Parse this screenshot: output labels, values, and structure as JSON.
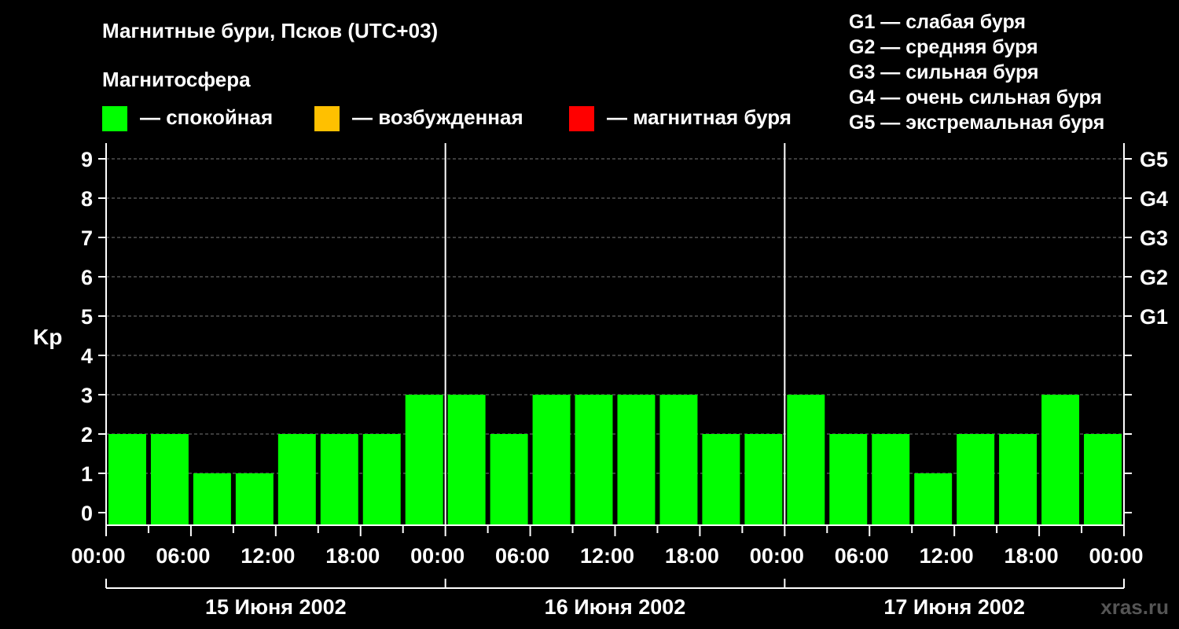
{
  "title": "Магнитные бури, Псков (UTC+03)",
  "magnetosphere_label": "Магнитосфера",
  "legend": [
    {
      "label": "— спокойная",
      "color": "#00ff00"
    },
    {
      "label": "— возбужденная",
      "color": "#ffc000"
    },
    {
      "label": "— магнитная буря",
      "color": "#ff0000"
    }
  ],
  "storm_levels": [
    "G1 — слабая буря",
    "G2 — средняя буря",
    "G3 — сильная буря",
    "G4 — очень сильная буря",
    "G5 — экстремальная буря"
  ],
  "watermark": "xras.ru",
  "chart_data": {
    "type": "bar",
    "ylabel": "Kp",
    "ylim": [
      0,
      9
    ],
    "y_ticks": [
      "0",
      "1",
      "2",
      "3",
      "4",
      "5",
      "6",
      "7",
      "8",
      "9"
    ],
    "right_ticks": [
      {
        "kp": 5,
        "label": "G1"
      },
      {
        "kp": 6,
        "label": "G2"
      },
      {
        "kp": 7,
        "label": "G3"
      },
      {
        "kp": 8,
        "label": "G4"
      },
      {
        "kp": 9,
        "label": "G5"
      }
    ],
    "grid": "dashed horizontal",
    "x_tick_labels": [
      "00:00",
      "06:00",
      "12:00",
      "18:00",
      "00:00",
      "06:00",
      "12:00",
      "18:00",
      "00:00",
      "06:00",
      "12:00",
      "18:00",
      "00:00"
    ],
    "days": [
      "15 Июня 2002",
      "16 Июня 2002",
      "17 Июня 2002"
    ],
    "interval_hours": 3,
    "values": [
      2,
      2,
      1,
      1,
      2,
      2,
      2,
      3,
      3,
      2,
      3,
      3,
      3,
      3,
      2,
      2,
      3,
      2,
      2,
      1,
      2,
      2,
      3,
      2
    ],
    "bar_color": "#00ff00"
  }
}
